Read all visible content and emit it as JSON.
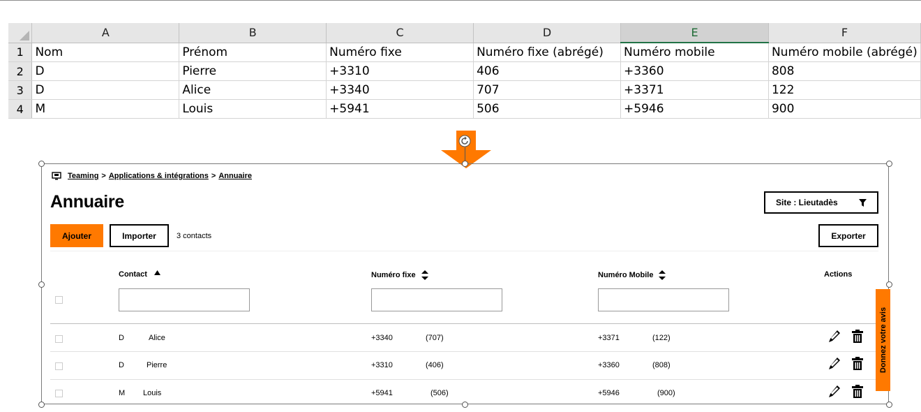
{
  "spreadsheet": {
    "columns": [
      "A",
      "B",
      "C",
      "D",
      "E",
      "F"
    ],
    "rows": [
      {
        "num": "1",
        "cells": [
          "Nom",
          "Prénom",
          "Numéro fixe",
          "Numéro fixe (abrégé)",
          "Numéro mobile",
          "Numéro mobile (abrégé)"
        ]
      },
      {
        "num": "2",
        "cells": [
          "D",
          "Pierre",
          "+3310",
          "406",
          "+3360",
          "808"
        ]
      },
      {
        "num": "3",
        "cells": [
          "D",
          "Alice",
          "+3340",
          "707",
          "+3371",
          "122"
        ]
      },
      {
        "num": "4",
        "cells": [
          "M",
          "Louis",
          "+5941",
          "506",
          "+5946",
          "900"
        ]
      }
    ],
    "selected_column": "E"
  },
  "app": {
    "breadcrumb": {
      "root": "Teaming",
      "sep1": ">",
      "middle": "Applications & intégrations",
      "sep2": ">",
      "current": "Annuaire"
    },
    "title": "Annuaire",
    "site_filter": "Site : Lieutadès",
    "buttons": {
      "add": "Ajouter",
      "import": "Importer",
      "export": "Exporter"
    },
    "contact_count": "3 contacts",
    "table": {
      "headers": {
        "contact": "Contact",
        "fixed": "Numéro fixe",
        "mobile": "Numéro Mobile",
        "actions": "Actions"
      },
      "rows": [
        {
          "nom": "D",
          "prenom": "Alice",
          "fixe": "+3340",
          "fixe_abrege": "(707)",
          "mobile": "+3371",
          "mobile_abrege": "(122)"
        },
        {
          "nom": "D",
          "prenom": "Pierre",
          "fixe": "+3310",
          "fixe_abrege": "(406)",
          "mobile": "+3360",
          "mobile_abrege": "(808)"
        },
        {
          "nom": "M",
          "prenom": "Louis",
          "fixe": "+5941",
          "fixe_abrege": "(506)",
          "mobile": "+5946",
          "mobile_abrege": "(900)"
        }
      ]
    },
    "feedback_tab": "Donnez votre avis"
  },
  "colors": {
    "accent": "#ff7900",
    "excel_green": "#217346"
  }
}
